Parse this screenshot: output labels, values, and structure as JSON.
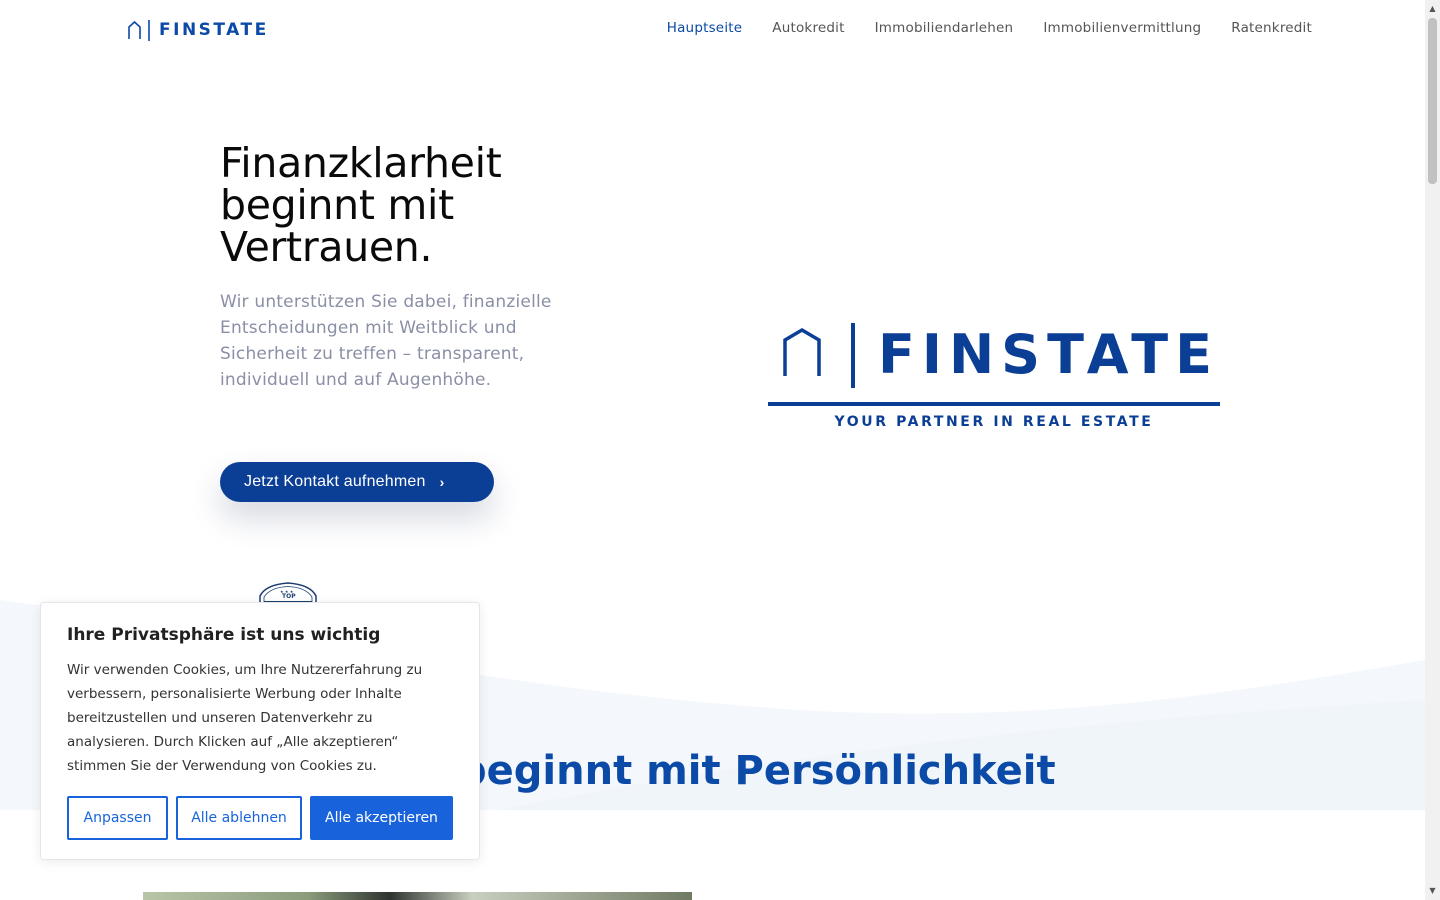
{
  "header": {
    "logo_text": "FINSTATE",
    "nav": [
      {
        "label": "Hauptseite",
        "active": true
      },
      {
        "label": "Autokredit",
        "active": false
      },
      {
        "label": "Immobiliendarlehen",
        "active": false
      },
      {
        "label": "Immobilienvermittlung",
        "active": false
      },
      {
        "label": "Ratenkredit",
        "active": false
      }
    ]
  },
  "hero": {
    "title": "Finanzklarheit beginnt mit Vertrauen.",
    "subtitle": "Wir unterstützen Sie dabei, finanzielle Entscheidungen mit Weitblick und Sicherheit zu treffen – transparent, individuell und auf Augenhöhe.",
    "cta_label": "Jetzt Kontakt aufnehmen",
    "brand_logo": {
      "name": "FINSTATE",
      "tagline": "YOUR PARTNER IN REAL ESTATE"
    },
    "badge_text": "TOP"
  },
  "section": {
    "title": "uen beginnt mit Persönlichkeit"
  },
  "cookie": {
    "title": "Ihre Privatsphäre ist uns wichtig",
    "text": "Wir verwenden Cookies, um Ihre Nutzererfahrung zu verbessern, personalisierte Werbung oder Inhalte bereitzustellen und unseren Datenverkehr zu analysieren. Durch Klicken auf „Alle akzeptieren“ stimmen Sie der Verwendung von Cookies zu.",
    "customize_label": "Anpassen",
    "reject_label": "Alle ablehnen",
    "accept_label": "Alle akzeptieren"
  },
  "colors": {
    "brand": "#0b3f95",
    "accent": "#1863dc",
    "subtitle_text": "#8a8fa6"
  }
}
